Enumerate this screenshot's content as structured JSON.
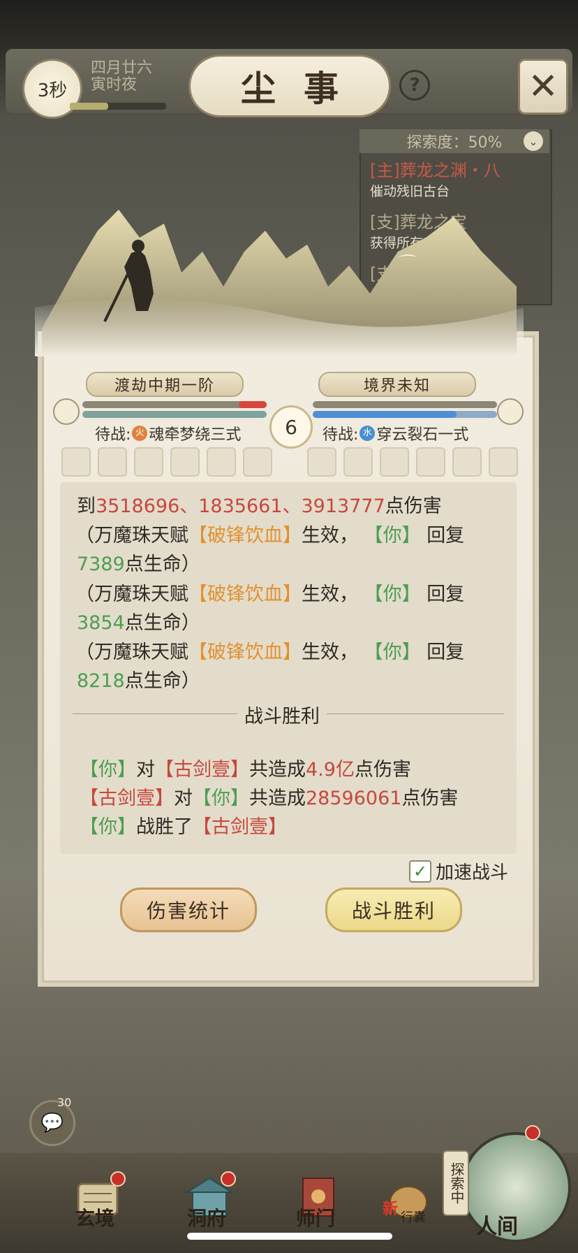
{
  "header": {
    "timer": "3秒",
    "date_line1": "四月廿六",
    "date_line2": "寅时夜",
    "title": "尘事",
    "help": "?",
    "time_progress": 0.4
  },
  "quest_panel": {
    "progress": "探索度：50%",
    "items": [
      {
        "title": "[主]葬龙之渊・八",
        "desc": "催动残旧古台"
      },
      {
        "title": "[支]葬龙之宝",
        "desc": "获得所有宝"
      },
      {
        "title": "[支]葬龙",
        "desc": ""
      }
    ]
  },
  "battle": {
    "left_realm": "渡劫中期一阶",
    "right_realm": "境界未知",
    "left_hp": 0.15,
    "right_mp": 0.78,
    "round": "6",
    "left_pending": "待战:",
    "left_element": "火",
    "left_skill": "魂牵梦绕三式",
    "right_pending": "待战:",
    "right_element": "水",
    "right_skill": "穿云裂石一式"
  },
  "log": {
    "l1_prefix": "到",
    "l1_values": "3518696、1835661、3913777",
    "l1_suffix": "点伤害",
    "talent_a": "（万魔珠天赋",
    "talent_name": "【破锋饮血】",
    "effect": "生效，",
    "you": "【你】",
    "recover": "回复",
    "heal1": "7389",
    "heal2": "3854",
    "heal3": "8218",
    "heal_suffix": "点生命）",
    "victory_divider": "战斗胜利",
    "enemy": "【古剑壹】",
    "vs": "对",
    "total": "共造成",
    "dmg_you": "4.9亿",
    "dmg_enemy": "28596061",
    "dmg_suffix": "点伤害",
    "won": "战胜了"
  },
  "controls": {
    "speed_label": "加速战斗",
    "speed_checked": true,
    "damage_stats": "伤害统计",
    "victory": "战斗胜利"
  },
  "chat": {
    "badge": "30"
  },
  "nav": {
    "xuanjing": "玄境",
    "dongfu": "洞府",
    "shimen": "师门",
    "xingnang": "行囊",
    "xingnang_tag": "新",
    "explore": "探索中",
    "renjian": "人间"
  },
  "colors": {
    "damage": "#c9463d",
    "heal": "#4d9d52",
    "talent": "#e2912f"
  }
}
